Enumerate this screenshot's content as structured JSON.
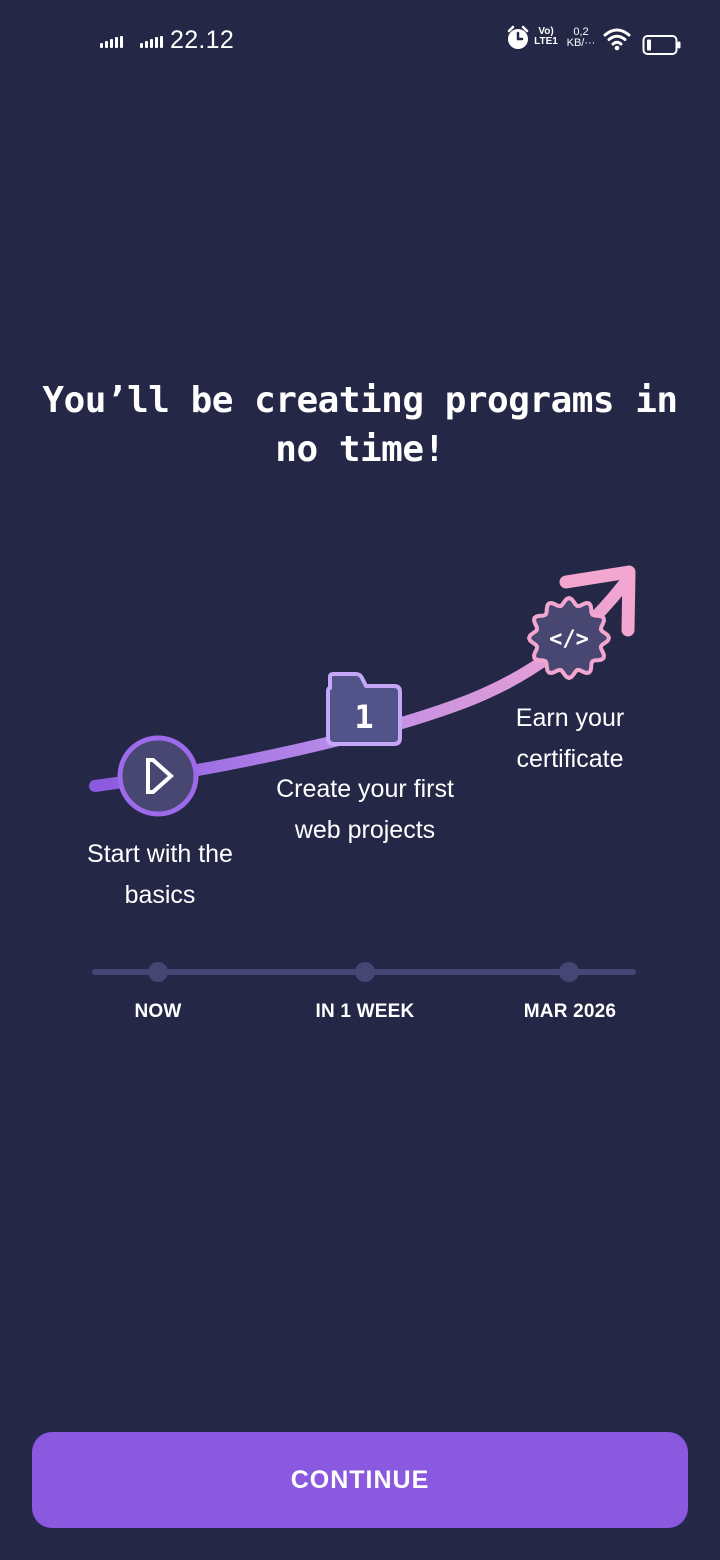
{
  "status_bar": {
    "time": "22.12",
    "volte_line1": "Vo)",
    "volte_line2": "LTE1",
    "net_speed_value": "0,2",
    "net_speed_unit": "KB/···",
    "icons": [
      "signal-icon",
      "signal-icon",
      "alarm-icon",
      "wifi-icon",
      "battery-icon"
    ]
  },
  "heading": "You’ll be creating programs in no time!",
  "milestones": [
    {
      "label": "Start with the basics",
      "icon": "play-icon"
    },
    {
      "label": "Create your first web projects",
      "icon": "folder-icon",
      "badge": "1"
    },
    {
      "label": "Earn your certificate",
      "icon": "certificate-icon",
      "badge": "</>"
    }
  ],
  "timeline": [
    "NOW",
    "IN 1 WEEK",
    "MAR 2026"
  ],
  "continue_label": "CONTINUE",
  "colors": {
    "background": "#252746",
    "accent": "#8a59e0",
    "curve_start": "#8a59e0",
    "curve_end": "#f3a6cf",
    "timeline": "#454674"
  }
}
